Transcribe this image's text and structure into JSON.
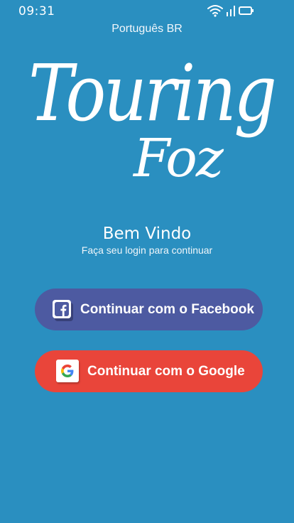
{
  "status_bar": {
    "time": "09:31",
    "icons": [
      "wifi-icon",
      "signal-icon",
      "battery-icon"
    ]
  },
  "language": "Português BR",
  "logo": {
    "line1": "Touring",
    "line2": "Foz"
  },
  "welcome": {
    "title": "Bem Vindo",
    "subtitle": "Faça seu login para continuar"
  },
  "buttons": {
    "facebook": {
      "label": "Continuar com o Facebook",
      "icon": "facebook-icon",
      "color": "#4d5aa1"
    },
    "google": {
      "label": "Continuar com o Google",
      "icon": "google-icon",
      "color": "#e9453a"
    }
  },
  "colors": {
    "background": "#2a8fc0",
    "text": "#ffffff"
  }
}
